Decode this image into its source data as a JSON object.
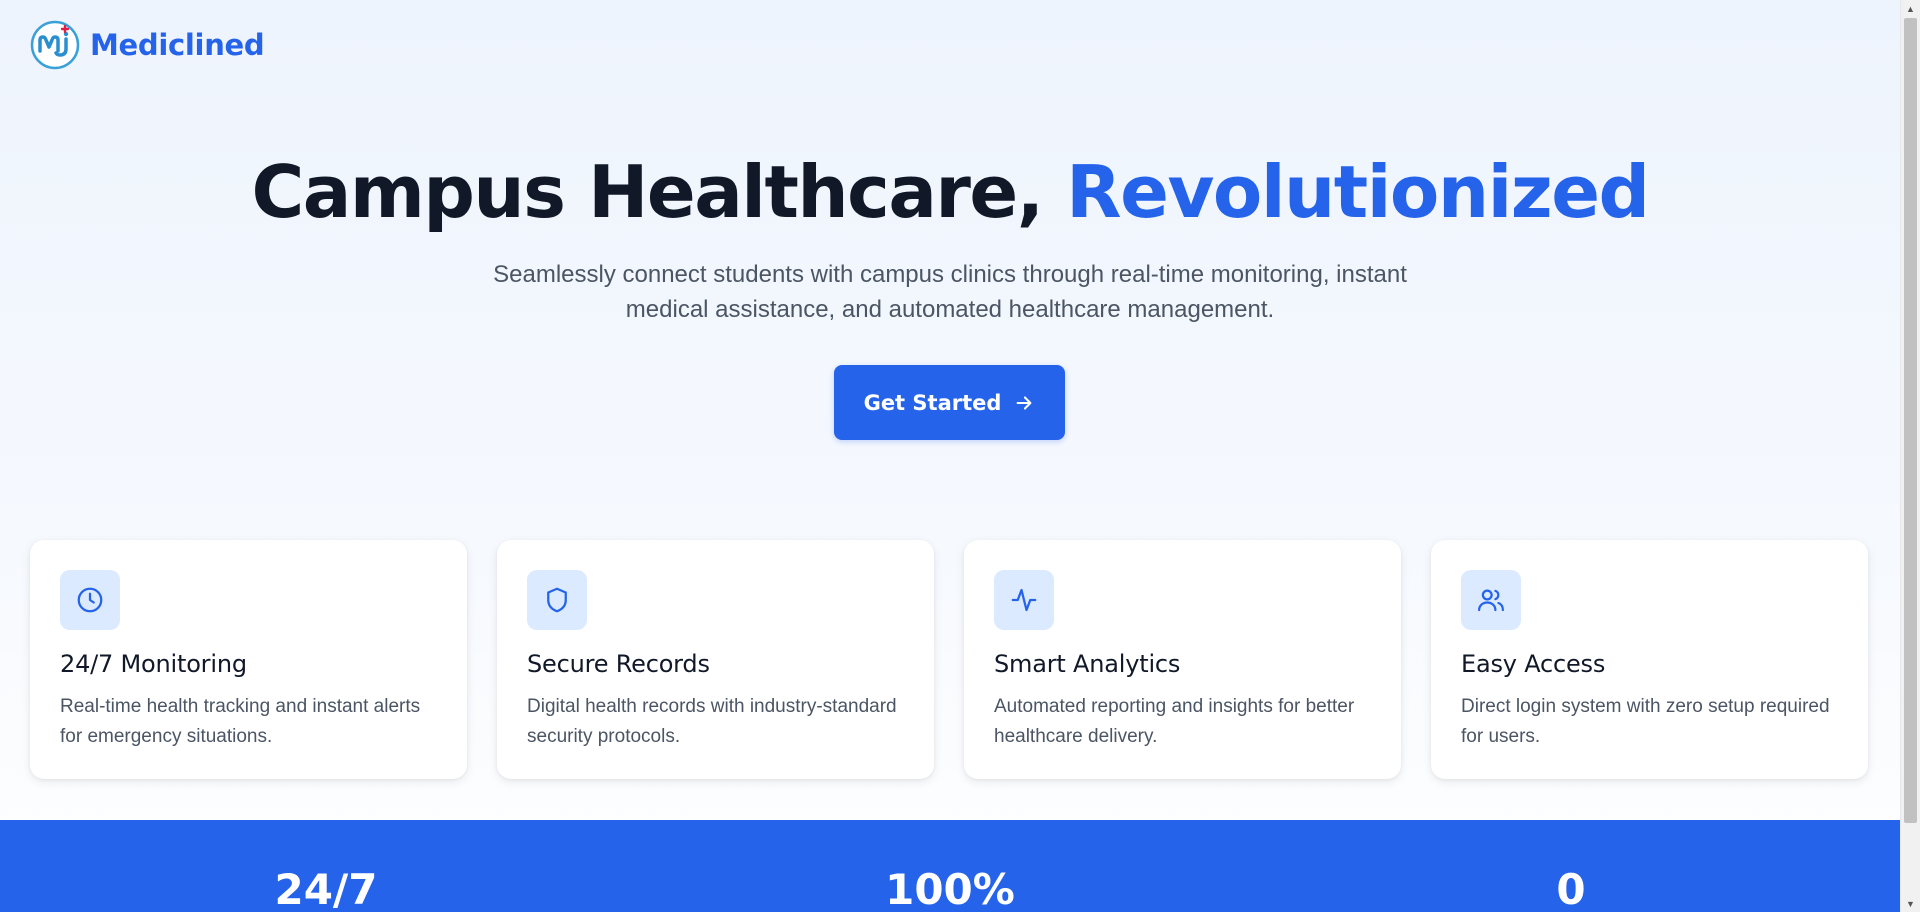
{
  "brand": {
    "name": "Mediclined",
    "logo_icon": "medical-cross-logo"
  },
  "hero": {
    "title_main": "Campus Healthcare,",
    "title_accent": "Revolutionized",
    "subtitle": "Seamlessly connect students with campus clinics through real-time monitoring, instant medical assistance, and automated healthcare management.",
    "cta_label": "Get Started",
    "cta_icon": "arrow-right-icon"
  },
  "features": [
    {
      "icon": "clock-icon",
      "title": "24/7 Monitoring",
      "description": "Real-time health tracking and instant alerts for emergency situations."
    },
    {
      "icon": "shield-icon",
      "title": "Secure Records",
      "description": "Digital health records with industry-standard security protocols."
    },
    {
      "icon": "activity-icon",
      "title": "Smart Analytics",
      "description": "Automated reporting and insights for better healthcare delivery."
    },
    {
      "icon": "users-icon",
      "title": "Easy Access",
      "description": "Direct login system with zero setup required for users."
    }
  ],
  "stats": [
    {
      "value": "24/7"
    },
    {
      "value": "100%"
    },
    {
      "value": "0"
    }
  ],
  "colors": {
    "primary": "#2563eb",
    "icon_bg": "#dbeafe",
    "heading": "#111827",
    "body_text": "#4b5563"
  }
}
